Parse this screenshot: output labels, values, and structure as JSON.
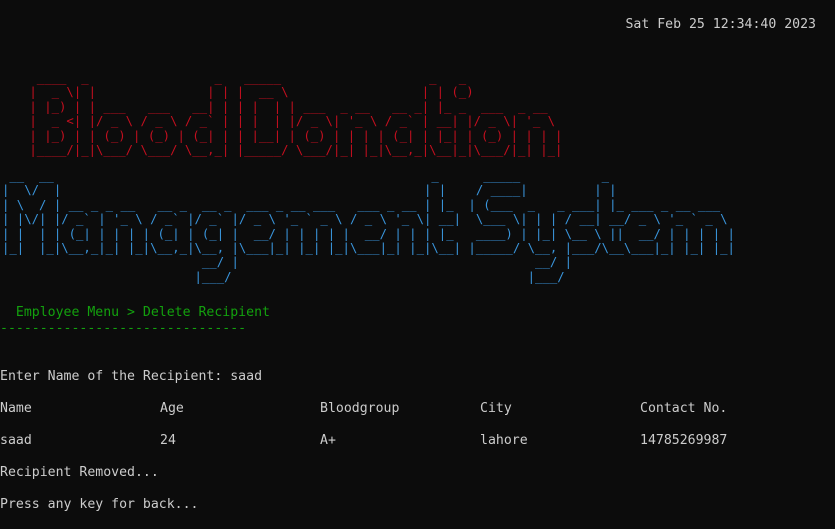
{
  "clock": "Sat Feb 25 12:34:40 2023",
  "banner": {
    "title_line1_ascii": "  ____  _                 _   _____                    _   _             \n |  _ \\| |               | | |  __ \\                  | | (_)            \n | |_) | | ___   ___   __| | | |  | | ___  _ __   __ _| |_ _  ___  _ __  \n |  _ <| |/ _ \\ / _ \\ / _` | | |  | |/ _ \\| '_ \\ / _` | __| |/ _ \\| '_ \\ \n | |_) | | (_) | (_) | (_| | | |__| | (_) | | | | (_| | |_| | (_) | | | |\n |____/|_|\\___/ \\___/ \\__,_| |_____/ \\___/|_| |_|\\__,_|\\__|_|\\___/|_| |_|",
    "title_line2_ascii": " __  __                                                   _      _____           _                 \n|  \\/  |                                                 | |    / ____|         | |                \n| \\  / | __ _ _ __   __ _  __ _  ___ _ __ ___   ___ _ __ | |_  | (___  _   _ ___| |_ ___ _ __ ___  \n| |\\/| |/ _` | '_ \\ / _` |/ _` |/ _ \\ '_ ` _ \\ / _ \\ '_ \\| __|  \\___ \\| | | / __| __/ _ \\ '_ ` _ \\ \n| |  | | (_| | | | | (_| | (_| |  __/ | | | | |  __/ | | | |_   ____) | |_| \\__ \\ ||  __/ | | | | |\n|_|  |_|\\__,_|_| |_|\\__,_|\\__, |\\___|_| |_| |_|\\___|_| |_|\\__| |_____/ \\__, |___/\\__\\___|_| |_| |_|\n                           __/ |                                        __/ |                      \n                          |___/                                        |___/                       "
  },
  "breadcrumb": "  Employee Menu > Delete Recipient",
  "divider": "-------------------------------",
  "prompt": "Enter Name of the Recipient: saad",
  "table": {
    "headers": [
      "Name",
      "Age",
      "Bloodgroup",
      "City",
      "Contact No."
    ],
    "rows": [
      [
        "saad",
        "24",
        "A+",
        "lahore",
        "14785269987"
      ]
    ]
  },
  "status": "Recipient Removed...",
  "back_prompt": "Press any key for back...",
  "colors": {
    "background": "#0c0c0c",
    "text": "#cccccc",
    "title_red": "#c50f1f",
    "title_cyan": "#3a96dd",
    "menu_green": "#13a10e"
  }
}
